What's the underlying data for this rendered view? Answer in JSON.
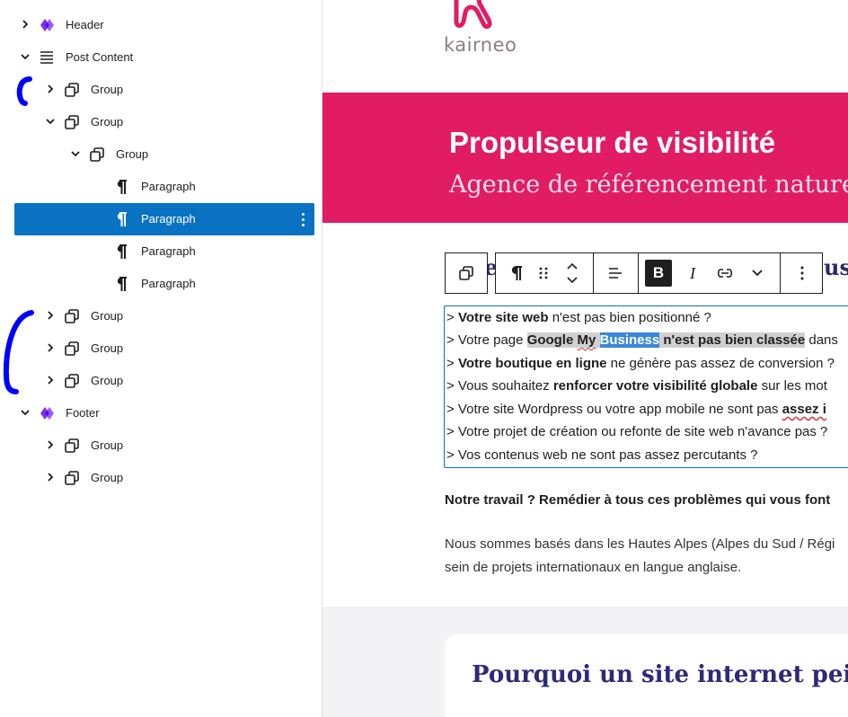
{
  "list_view": {
    "items": [
      {
        "label": "Header",
        "icon": "template-part-icon",
        "expanded": false
      },
      {
        "label": "Post Content",
        "icon": "post-content-icon",
        "expanded": true
      },
      {
        "label": "Group",
        "icon": "group-icon",
        "expanded": false
      },
      {
        "label": "Group",
        "icon": "group-icon",
        "expanded": true
      },
      {
        "label": "Group",
        "icon": "group-icon",
        "expanded": true
      },
      {
        "label": "Paragraph",
        "icon": "paragraph-icon"
      },
      {
        "label": "Paragraph",
        "icon": "paragraph-icon",
        "selected": true
      },
      {
        "label": "Paragraph",
        "icon": "paragraph-icon"
      },
      {
        "label": "Paragraph",
        "icon": "paragraph-icon"
      },
      {
        "label": "Group",
        "icon": "group-icon",
        "expanded": false
      },
      {
        "label": "Group",
        "icon": "group-icon",
        "expanded": false
      },
      {
        "label": "Group",
        "icon": "group-icon",
        "expanded": false
      },
      {
        "label": "Footer",
        "icon": "template-part-icon",
        "expanded": true
      },
      {
        "label": "Group",
        "icon": "group-icon",
        "expanded": false
      },
      {
        "label": "Group",
        "icon": "group-icon",
        "expanded": false
      }
    ],
    "selected_color": "#0a72c2",
    "annotation_color": "#0000ff"
  },
  "site": {
    "logo_text": "kairneo",
    "hero_title": "Propulseur de visibilité",
    "hero_subtitle": "Agence de référencement naturel Ha",
    "hero_color": "#e11c63",
    "heading_peek_left": "e",
    "heading_peek_right": "us"
  },
  "toolbar": {
    "bold": "B",
    "italic": "I"
  },
  "paragraph": {
    "line1": {
      "a": "> ",
      "b": "Votre site web",
      "c": " n'est pas bien positionné ?"
    },
    "line2": {
      "a": "> Votre page ",
      "b": "Google ",
      "c": "My",
      "d": " ",
      "e": "Business",
      "f": " n'est pas bien classée",
      "g": " dans"
    },
    "line3": {
      "a": "> ",
      "b": "Votre boutique en ligne",
      "c": " ne génère pas assez de conversion ?"
    },
    "line4": {
      "a": "> Vous souhaitez ",
      "b": "renforcer votre visibilité globale",
      "c": " sur les mot"
    },
    "line5": {
      "a": "> Votre site Wordpress ou votre app mobile ne sont pas ",
      "b": "assez i"
    },
    "line6": "> Votre projet de création ou refonte de site web n'avance pas ?",
    "line7": "> Vos contenus web ne sont pas assez percutants ?"
  },
  "content": {
    "bold_line": "Notre travail ? Remédier à tous ces problèmes qui vous font",
    "body_line1": "Nous sommes basés dans les Hautes Alpes (Alpes du Sud / Régi",
    "body_line2": "sein de projets internationaux en langue anglaise.",
    "card_title": "Pourquoi un site internet peine ge"
  }
}
